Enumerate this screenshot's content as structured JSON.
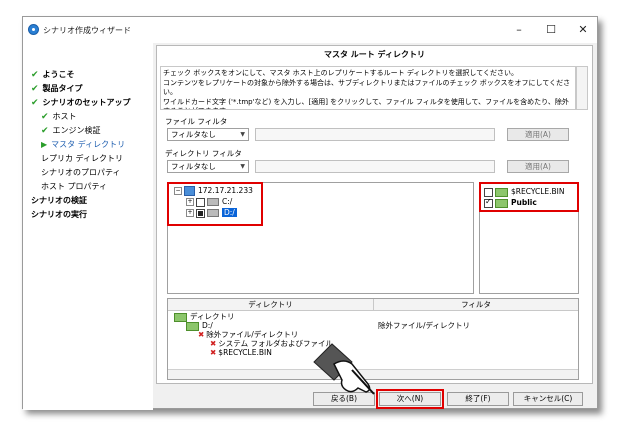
{
  "window": {
    "title": "シナリオ作成ウィザード",
    "minimize": "–",
    "maximize": "☐",
    "close": "✕"
  },
  "sidebar": {
    "items": [
      {
        "label": "ようこそ",
        "state": "done"
      },
      {
        "label": "製品タイプ",
        "state": "done"
      },
      {
        "label": "シナリオのセットアップ",
        "state": "done"
      },
      {
        "label": "ホスト",
        "state": "done"
      },
      {
        "label": "エンジン検証",
        "state": "done"
      },
      {
        "label": "マスタ ディレクトリ",
        "state": "current"
      },
      {
        "label": "レプリカ ディレクトリ",
        "state": "pending"
      },
      {
        "label": "シナリオのプロパティ",
        "state": "pending"
      },
      {
        "label": "ホスト プロパティ",
        "state": "pending"
      },
      {
        "label": "シナリオの検証",
        "state": "pending"
      },
      {
        "label": "シナリオの実行",
        "state": "pending"
      }
    ]
  },
  "main": {
    "header": "マスタ ルート ディレクトリ",
    "description": [
      "チェック ボックスをオンにして、マスタ ホスト上のレプリケートするルート ディレクトリを選択してください。",
      "コンテンツをレプリケートの対象から除外する場合は、サブディレクトリまたはファイルのチェック ボックスをオフにしてください。",
      "ワイルドカード文字 ('*.tmp'など) を入力し、[適用] をクリックして、ファイル フィルタを使用して、ファイルを含めたり、除外することができます。"
    ],
    "file_filter": {
      "label": "ファイル フィルタ",
      "selected": "フィルタなし",
      "apply": "適用(A)"
    },
    "dir_filter": {
      "label": "ディレクトリ フィルタ",
      "selected": "フィルタなし",
      "apply": "適用(A)"
    },
    "tree": {
      "host": "172.17.21.233",
      "drives": [
        "C:/",
        "D:/"
      ]
    },
    "folders": [
      {
        "name": "$RECYCLE.BIN",
        "checked": false
      },
      {
        "name": "Public",
        "checked": true
      }
    ],
    "grid": {
      "col_dir": "ディレクトリ",
      "col_filter": "フィルタ",
      "rows": [
        {
          "text": "ディレクトリ"
        },
        {
          "text": "D:/",
          "filter": "除外ファイル/ディレクトリ"
        },
        {
          "text": "除外ファイル/ディレクトリ"
        },
        {
          "text": "システム フォルダおよびファイル"
        },
        {
          "text": "$RECYCLE.BIN"
        }
      ]
    }
  },
  "buttons": {
    "back": "戻る(B)",
    "next": "次へ(N)",
    "finish": "終了(F)",
    "cancel": "キャンセル(C)"
  },
  "colors": {
    "highlight_box": "#e00000",
    "selection": "#0a64d8",
    "done_check": "#2a9d2a"
  }
}
